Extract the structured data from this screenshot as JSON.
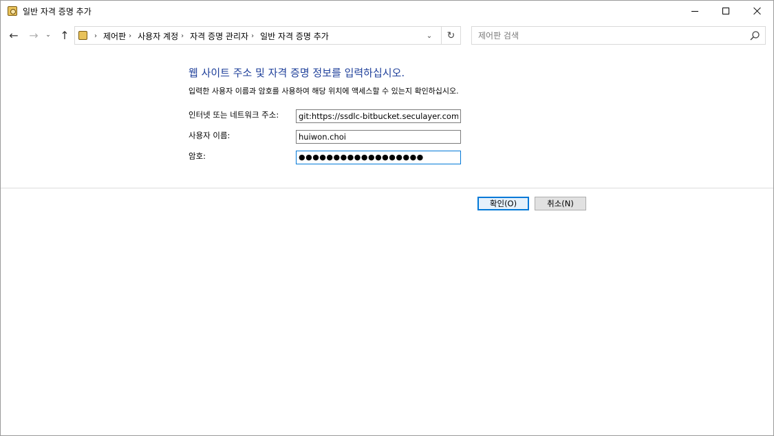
{
  "window": {
    "title": "일반 자격 증명 추가"
  },
  "nav": {
    "breadcrumbs": [
      "제어판",
      "사용자 계정",
      "자격 증명 관리자",
      "일반 자격 증명 추가"
    ],
    "search_placeholder": "제어판 검색"
  },
  "form": {
    "heading": "웹 사이트 주소 및 자격 증명 정보를 입력하십시오.",
    "subtext": "입력한 사용자 이름과 암호를 사용하여 해당 위치에 액세스할 수 있는지 확인하십시오.",
    "address_label": "인터넷 또는 네트워크 주소:",
    "address_value": "git:https://ssdlc-bitbucket.seculayer.com",
    "username_label": "사용자 이름:",
    "username_value": "huiwon.choi",
    "password_label": "암호:",
    "password_mask": "●●●●●●●●●●●●●●●●●●"
  },
  "buttons": {
    "ok_label": "확인(O)",
    "cancel_label": "취소(N)"
  },
  "colors": {
    "heading": "#1e3f9a",
    "focus_border": "#0078d7"
  }
}
